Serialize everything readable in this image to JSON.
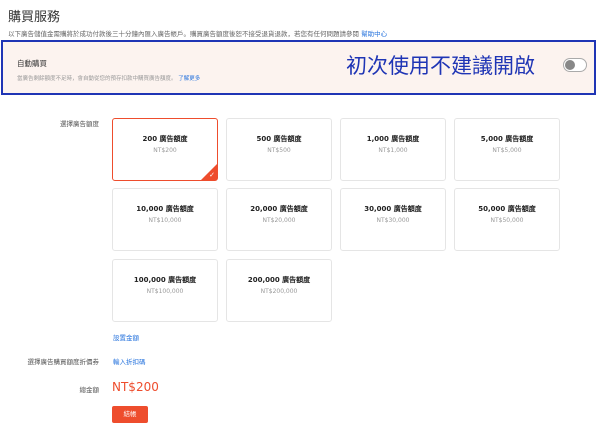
{
  "header": {
    "title": "購買服務",
    "description": "以下廣告儲值金需購將於成功付款後三十分鐘內匯入廣告帳戶。購買廣告額度後恕不接受退貨退款，若您有任何問題請參閱",
    "help_link": "幫助中心"
  },
  "auto_purchase": {
    "title": "自動購買",
    "description": "當廣告剩餘額度不足時，會自動從您的預存扣款中購買廣告額度。",
    "learn_more": "了解更多",
    "annotation": "初次使用不建議開啟",
    "toggle_state": "off"
  },
  "amount_section": {
    "label": "選擇廣告額度",
    "options": [
      {
        "title": "200 廣告額度",
        "price": "NT$200",
        "selected": true
      },
      {
        "title": "500 廣告額度",
        "price": "NT$500",
        "selected": false
      },
      {
        "title": "1,000 廣告額度",
        "price": "NT$1,000",
        "selected": false
      },
      {
        "title": "5,000 廣告額度",
        "price": "NT$5,000",
        "selected": false
      },
      {
        "title": "10,000 廣告額度",
        "price": "NT$10,000",
        "selected": false
      },
      {
        "title": "20,000 廣告額度",
        "price": "NT$20,000",
        "selected": false
      },
      {
        "title": "30,000 廣告額度",
        "price": "NT$30,000",
        "selected": false
      },
      {
        "title": "50,000 廣告額度",
        "price": "NT$50,000",
        "selected": false
      },
      {
        "title": "100,000 廣告額度",
        "price": "NT$100,000",
        "selected": false
      },
      {
        "title": "200,000 廣告額度",
        "price": "NT$200,000",
        "selected": false
      }
    ],
    "custom_amount_link": "設置金額"
  },
  "coupon": {
    "label": "選擇廣告購買額度折價券",
    "input_link": "輸入折扣碼"
  },
  "total": {
    "label": "總金額",
    "amount": "NT$200"
  },
  "checkout": {
    "label": "結帳"
  },
  "colors": {
    "accent": "#ee4d2d",
    "link": "#2673dd",
    "annotation": "#1f35b5",
    "auto_bg": "#fcf3ef"
  }
}
